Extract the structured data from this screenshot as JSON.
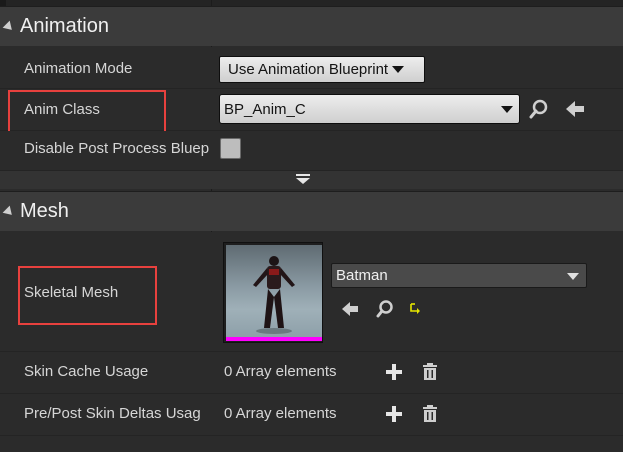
{
  "animation": {
    "header": "Animation",
    "mode_label": "Animation Mode",
    "mode_value": "Use Animation Blueprint",
    "anim_class_label": "Anim Class",
    "anim_class_value": "BP_Anim_C",
    "disable_post_label": "Disable Post Process Bluep"
  },
  "mesh": {
    "header": "Mesh",
    "skeletal_label": "Skeletal Mesh",
    "skeletal_value": "Batman",
    "skin_cache_label": "Skin Cache Usage",
    "skin_cache_value": "0 Array elements",
    "skin_deltas_label": "Pre/Post Skin Deltas Usag",
    "skin_deltas_value": "0 Array elements"
  },
  "icons": {
    "browse": "magnifier-icon",
    "use_selected": "left-arrow-icon",
    "reset": "reset-to-default-icon",
    "add": "plus-icon",
    "delete": "trash-icon",
    "collapse": "triangle-icon",
    "expand_advanced": "double-chevron-down-icon"
  },
  "colors": {
    "highlight": "#e8413e",
    "thumbnail_bar": "#ff00ff",
    "reset_icon": "#e6e600"
  }
}
